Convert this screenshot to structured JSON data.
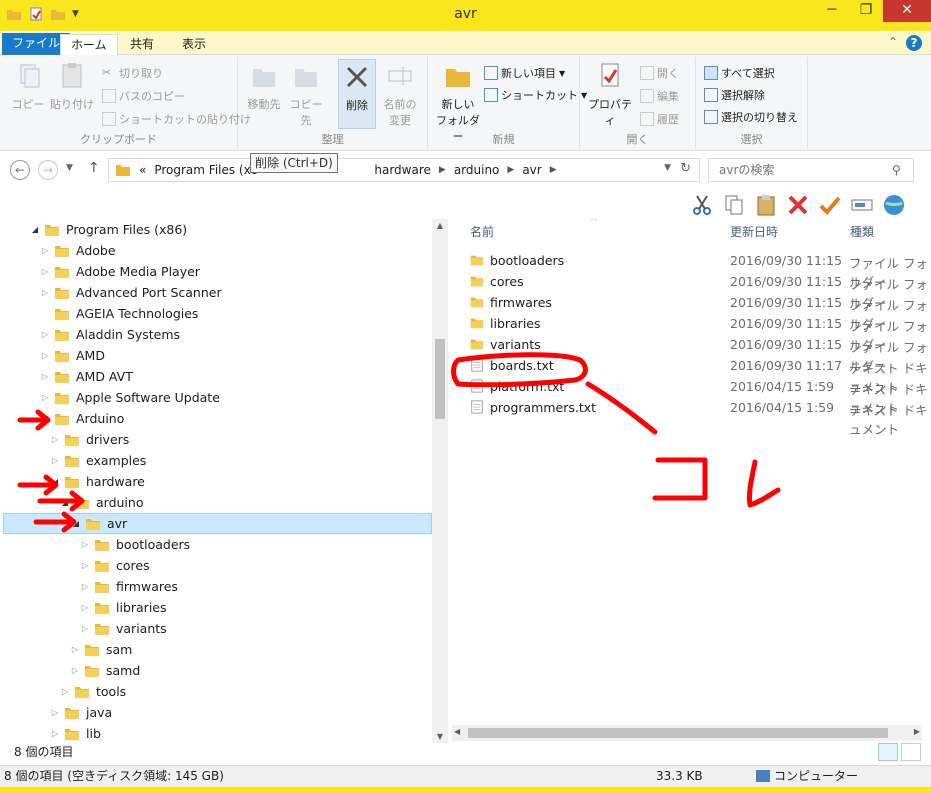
{
  "window": {
    "title": "avr"
  },
  "ribbon_tabs": [
    "ファイル",
    "ホーム",
    "共有",
    "表示"
  ],
  "clipboard": {
    "copy": "コピー",
    "paste": "貼り付け",
    "cut": "切り取り",
    "copy_path": "パスのコピー",
    "paste_shortcut": "ショートカットの貼り付け",
    "label": "クリップボード"
  },
  "organize": {
    "move_to": "移動先",
    "copy_to": "コピー先",
    "delete": "削除",
    "rename_line1": "名前の",
    "rename_line2": "変更",
    "label": "整理"
  },
  "new_group": {
    "new_item": "新しい項目",
    "shortcut": "ショートカット",
    "new_folder_line1": "新しい",
    "new_folder_line2": "フォルダー",
    "label": "新規"
  },
  "open_group": {
    "properties": "プロパティ",
    "open": "開く",
    "edit": "編集",
    "history": "履歴",
    "label": "開く"
  },
  "select_group": {
    "select_all": "すべて選択",
    "select_none": "選択解除",
    "invert": "選択の切り替え",
    "label": "選択"
  },
  "address": {
    "breadcrumbs": [
      "Program Files (x8",
      "hardware",
      "arduino",
      "avr"
    ],
    "prefix": "«",
    "search_placeholder": "avrの検索"
  },
  "tooltip": "削除 (Ctrl+D)",
  "tree": [
    {
      "label": "Program Files (x86)",
      "level": 0,
      "expanded": true
    },
    {
      "label": "Adobe",
      "level": 1
    },
    {
      "label": "Adobe Media Player",
      "level": 1
    },
    {
      "label": "Advanced Port Scanner",
      "level": 1
    },
    {
      "label": "AGEIA Technologies",
      "level": 1,
      "noarrow": true
    },
    {
      "label": "Aladdin Systems",
      "level": 1
    },
    {
      "label": "AMD",
      "level": 1
    },
    {
      "label": "AMD AVT",
      "level": 1
    },
    {
      "label": "Apple Software Update",
      "level": 1
    },
    {
      "label": "Arduino",
      "level": 1,
      "expanded": true
    },
    {
      "label": "drivers",
      "level": 2
    },
    {
      "label": "examples",
      "level": 2
    },
    {
      "label": "hardware",
      "level": 2,
      "expanded": true
    },
    {
      "label": "arduino",
      "level": 3,
      "expanded": true
    },
    {
      "label": "avr",
      "level": 4,
      "expanded": true,
      "selected": true
    },
    {
      "label": "bootloaders",
      "level": 5
    },
    {
      "label": "cores",
      "level": 5
    },
    {
      "label": "firmwares",
      "level": 5
    },
    {
      "label": "libraries",
      "level": 5
    },
    {
      "label": "variants",
      "level": 5
    },
    {
      "label": "sam",
      "level": 4
    },
    {
      "label": "samd",
      "level": 4
    },
    {
      "label": "tools",
      "level": 3
    },
    {
      "label": "java",
      "level": 2
    },
    {
      "label": "lib",
      "level": 2
    }
  ],
  "columns": {
    "name": "名前",
    "date": "更新日時",
    "type": "種類"
  },
  "files": [
    {
      "name": "bootloaders",
      "date": "2016/09/30 11:15",
      "type": "ファイル フォルダー",
      "kind": "folder"
    },
    {
      "name": "cores",
      "date": "2016/09/30 11:15",
      "type": "ファイル フォルダー",
      "kind": "folder"
    },
    {
      "name": "firmwares",
      "date": "2016/09/30 11:15",
      "type": "ファイル フォルダー",
      "kind": "folder"
    },
    {
      "name": "libraries",
      "date": "2016/09/30 11:15",
      "type": "ファイル フォルダー",
      "kind": "folder"
    },
    {
      "name": "variants",
      "date": "2016/09/30 11:15",
      "type": "ファイル フォルダー",
      "kind": "folder"
    },
    {
      "name": "boards.txt",
      "date": "2016/09/30 11:17",
      "type": "テキスト ドキュメント",
      "kind": "text"
    },
    {
      "name": "platform.txt",
      "date": "2016/04/15 1:59",
      "type": "テキスト ドキュメント",
      "kind": "text"
    },
    {
      "name": "programmers.txt",
      "date": "2016/04/15 1:59",
      "type": "テキスト ドキュメント",
      "kind": "text"
    }
  ],
  "status": {
    "items_count": "8 個の項目",
    "items_free": "8 個の項目 (空きディスク領域: 145 GB)",
    "size": "33.3 KB",
    "computer": "コンピューター"
  },
  "annotation_text": "コレ",
  "colors": {
    "title_bar": "#f9e61c",
    "file_tab": "#1979ca",
    "selection": "#cce8ff",
    "annotation": "#ff0000"
  }
}
